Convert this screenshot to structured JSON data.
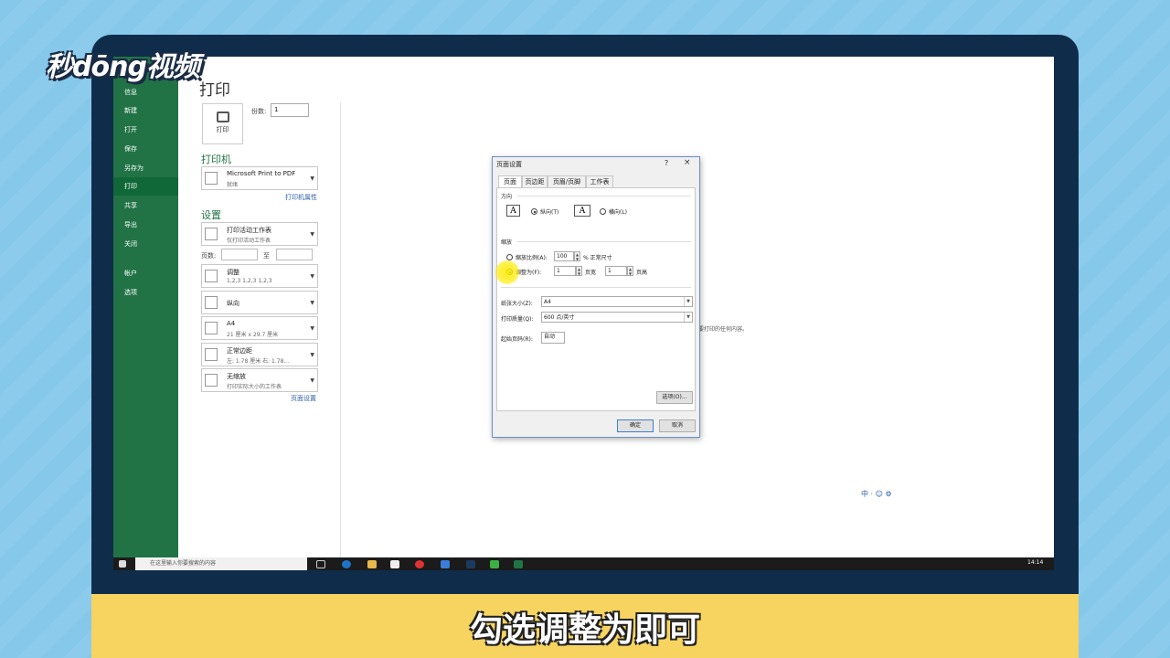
{
  "watermark": {
    "logo": "秒dōng视频"
  },
  "subtitle": "勾选调整为即可",
  "sidebar": {
    "items": [
      "信息",
      "新建",
      "打开",
      "保存",
      "另存为",
      "打印",
      "共享",
      "导出",
      "关闭",
      "帐户",
      "选项"
    ],
    "active": "打印"
  },
  "print": {
    "title": "打印",
    "button_label": "打印",
    "copies_label": "份数:",
    "copies_value": "1",
    "printer_heading": "打印机",
    "printer_name": "Microsoft Print to PDF",
    "printer_status": "就绪",
    "printer_props_link": "打印机属性",
    "settings_heading": "设置",
    "pages_label": "页数:",
    "pages_to_label": "至",
    "settings": [
      {
        "line1": "打印活动工作表",
        "line2": "仅打印活动工作表"
      },
      {
        "line1": "调整",
        "line2": "1,2,3    1,2,3    1,2,3"
      },
      {
        "line1": "纵向",
        "line2": ""
      },
      {
        "line1": "A4",
        "line2": "21 厘米 x 29.7 厘米"
      },
      {
        "line1": "正常边距",
        "line2": "左: 1.78 厘米    右: 1.78..."
      },
      {
        "line1": "无缩放",
        "line2": "打印实际大小的工作表"
      }
    ],
    "page_setup_link": "页面设置",
    "preview_text": "要打印的任何内容。"
  },
  "dialog": {
    "title": "页面设置",
    "help": "?",
    "close": "×",
    "tabs": [
      "页面",
      "页边距",
      "页眉/页脚",
      "工作表"
    ],
    "active_tab": "页面",
    "orientation_label": "方向",
    "portrait_label": "纵向(T)",
    "landscape_label": "横向(L)",
    "orientation_selected": "纵向(T)",
    "scaling_label": "缩放",
    "scale_ratio_label": "缩放比例(A):",
    "scale_ratio_value": "100",
    "scale_ratio_suffix": "% 正常尺寸",
    "fit_to_label": "调整为(F):",
    "fit_wide_value": "1",
    "fit_wide_suffix": "页宽",
    "fit_tall_value": "1",
    "fit_tall_suffix": "页高",
    "scaling_selected": "调整为(F):",
    "paper_size_label": "纸张大小(Z):",
    "paper_size_value": "A4",
    "print_quality_label": "打印质量(Q):",
    "print_quality_value": "600 点/英寸",
    "first_page_label": "起始页码(R):",
    "first_page_value": "自动",
    "options_button": "选项(O)...",
    "ok_button": "确定",
    "cancel_button": "取消",
    "orient_glyph": "A"
  },
  "taskbar": {
    "search_placeholder": "在这里输入你要搜索的内容",
    "time": "14:14",
    "tray": "中 · ☺ ⚙"
  }
}
